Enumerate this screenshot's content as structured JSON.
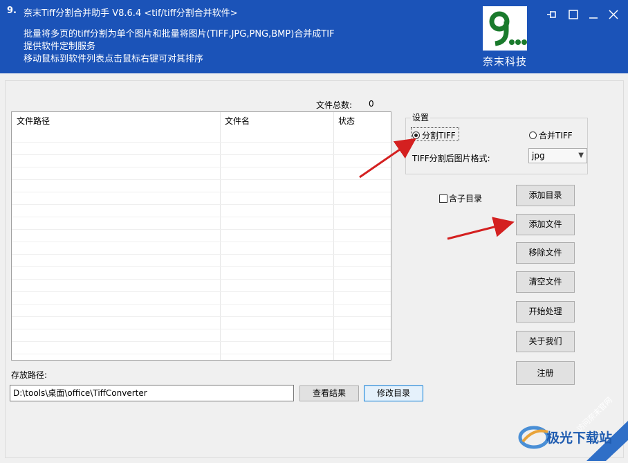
{
  "window": {
    "title": "奈末Tiff分割合并助手 V8.6.4   <tif/tiff分割合并软件>",
    "app_icon_glyph": "9.",
    "description_lines": [
      "批量将多页的tiff分割为单个图片和批量将图片(TIFF,JPG,PNG,BMP)合并成TIF",
      "提供软件定制服务",
      "移动鼠标到软件列表点击鼠标右键可对其排序"
    ],
    "logo_text": "奈末科技",
    "header_color": "#1b53b8",
    "controls": [
      "pin-icon",
      "maximize-icon",
      "minimize-icon",
      "close-icon"
    ]
  },
  "file_list": {
    "count_label": "文件总数:",
    "count_value": "0",
    "columns": [
      "文件路径",
      "文件名",
      "状态"
    ]
  },
  "settings": {
    "title": "设置",
    "split_label": "分割TIFF",
    "merge_label": "合并TIFF",
    "selected_mode": "split",
    "format_label": "TIFF分割后图片格式:",
    "format_value": "jpg"
  },
  "include_subdir_label": "含子目录",
  "buttons": {
    "add_dir": "添加目录",
    "add_file": "添加文件",
    "remove_file": "移除文件",
    "clear_files": "清空文件",
    "start": "开始处理",
    "about": "关于我们",
    "register": "注册",
    "view_result": "查看结果",
    "change_dir": "修改目录"
  },
  "save_path": {
    "label": "存放路径:",
    "value": "D:\\tools\\桌面\\office\\TiffConverter"
  },
  "watermark": {
    "brand": "极光下载站",
    "link": "访问奈末官网"
  },
  "annotation_color": "#d42020"
}
